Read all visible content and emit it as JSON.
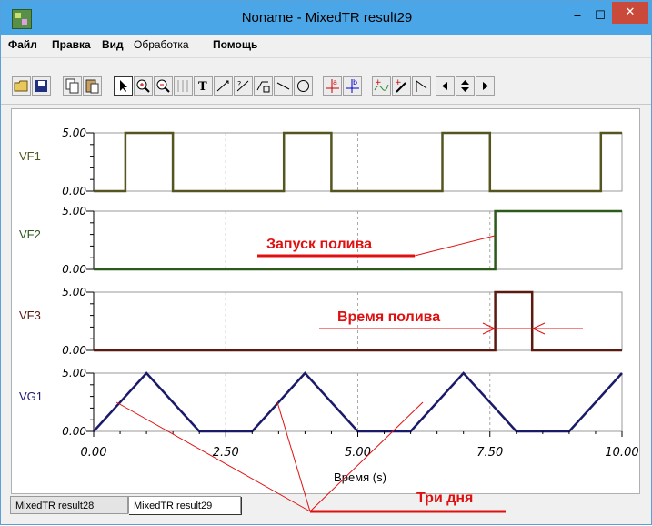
{
  "window": {
    "title": "Noname - MixedTR result29",
    "min_glyph": "‒",
    "max_glyph": "☐",
    "close_glyph": "✕"
  },
  "menu": [
    "Файл",
    "Правка",
    "Вид",
    "Обработка",
    "Помощь"
  ],
  "toolbar": {
    "icons": [
      "open-icon",
      "save-icon",
      "copy-icon",
      "paste-icon",
      "pointer-icon",
      "zoom-in-icon",
      "zoom-out-icon",
      "grid-icon",
      "text-icon",
      "cursor-a-icon",
      "cursor-b-icon",
      "formula-icon",
      "line-icon",
      "circle-icon",
      "marker-a-icon",
      "marker-b-icon",
      "add-curve-icon",
      "add-marker-icon",
      "step-icon",
      "scroll-left-icon",
      "scroll-updown-icon",
      "scroll-right-icon"
    ]
  },
  "chart_data": {
    "type": "line",
    "x_axis": {
      "label": "Время (s)",
      "ticks": [
        "0.00",
        "2.50",
        "5.00",
        "7.50",
        "10.00"
      ],
      "tick_values": [
        0,
        2.5,
        5,
        7.5,
        10
      ],
      "range": [
        0,
        10
      ]
    },
    "panels": [
      {
        "name": "VF1",
        "color": "#555520",
        "ylim": [
          0,
          5
        ],
        "y_ticks": [
          "5.00",
          "0.00"
        ],
        "points": [
          [
            0,
            0
          ],
          [
            0.6,
            0
          ],
          [
            0.6,
            5
          ],
          [
            1.5,
            5
          ],
          [
            1.5,
            0
          ],
          [
            3.6,
            0
          ],
          [
            3.6,
            5
          ],
          [
            4.5,
            5
          ],
          [
            4.5,
            0
          ],
          [
            6.6,
            0
          ],
          [
            6.6,
            5
          ],
          [
            7.5,
            5
          ],
          [
            7.5,
            0
          ],
          [
            9.6,
            0
          ],
          [
            9.6,
            5
          ],
          [
            10,
            5
          ]
        ]
      },
      {
        "name": "VF2",
        "color": "#2d5a1a",
        "ylim": [
          0,
          5
        ],
        "y_ticks": [
          "5.00",
          "0.00"
        ],
        "points": [
          [
            0,
            0
          ],
          [
            7.6,
            0
          ],
          [
            7.6,
            5
          ],
          [
            10,
            5
          ]
        ]
      },
      {
        "name": "VF3",
        "color": "#5a1a10",
        "ylim": [
          0,
          5
        ],
        "y_ticks": [
          "5.00",
          "0.00"
        ],
        "points": [
          [
            0,
            0
          ],
          [
            7.6,
            0
          ],
          [
            7.6,
            5
          ],
          [
            8.3,
            5
          ],
          [
            8.3,
            0
          ],
          [
            10,
            0
          ]
        ]
      },
      {
        "name": "VG1",
        "color": "#1a1a6a",
        "ylim": [
          0,
          5
        ],
        "y_ticks": [
          "5.00",
          "0.00"
        ],
        "points": [
          [
            0,
            0
          ],
          [
            1,
            5
          ],
          [
            2,
            0
          ],
          [
            3,
            0
          ],
          [
            4,
            5
          ],
          [
            5,
            0
          ],
          [
            6,
            0
          ],
          [
            7,
            5
          ],
          [
            8,
            0
          ],
          [
            9,
            0
          ],
          [
            10,
            5
          ]
        ]
      }
    ],
    "annotations": [
      {
        "text": "Запуск полива",
        "color": "#e01010"
      },
      {
        "text": "Время полива",
        "color": "#e01010"
      },
      {
        "text": "Три дня",
        "color": "#e01010"
      }
    ],
    "grid": true
  },
  "tabs": [
    "MixedTR result28",
    "MixedTR result29"
  ]
}
